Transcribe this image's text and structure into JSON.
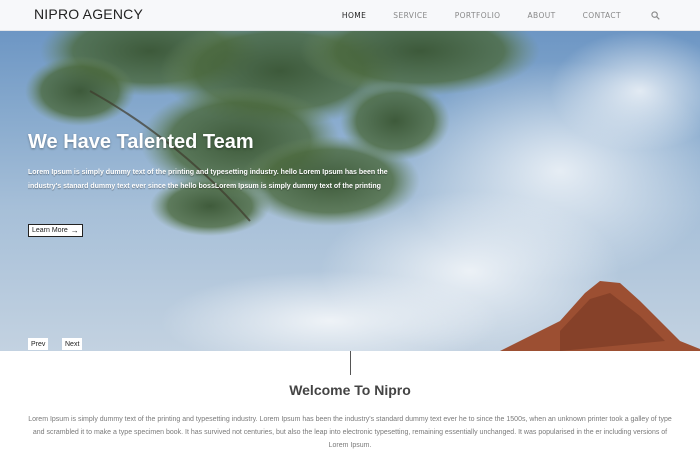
{
  "brand": "NIPRO AGENCY",
  "nav": {
    "items": [
      {
        "label": "HOME",
        "active": true
      },
      {
        "label": "SERVICE",
        "active": false
      },
      {
        "label": "PORTFOLIO",
        "active": false
      },
      {
        "label": "ABOUT",
        "active": false
      },
      {
        "label": "CONTACT",
        "active": false
      }
    ],
    "search_icon": "search-icon"
  },
  "hero": {
    "title": "We Have Talented Team",
    "text": "Lorem Ipsum is simply dummy text of the printing and typesetting industry. hello Lorem Ipsum has been the industry's stanard dummy text ever since the hello bossLorem Ipsum is simply dummy text of the printing",
    "button_label": "Learn More",
    "button_icon": "arrow-right-icon",
    "prev_label": "Prev",
    "next_label": "Next"
  },
  "welcome": {
    "title": "Welcome To Nipro",
    "text": "Lorem Ipsum is simply dummy text of the printing and typesetting industry. Lorem Ipsum has been the industry's standard dummy text ever he to since the 1500s, when an unknown printer took a galley of type and scrambled it to make a type specimen book. It has survived not centuries, but also the leap into electronic typesetting, remaining essentially unchanged. It was popularised in the er including versions of Lorem Ipsum."
  },
  "colors": {
    "nav_bg": "#f7f8fa",
    "sky": "#86a9cd",
    "foliage": "#2f4a2c",
    "rock": "#9c4f32",
    "body_text": "#7a7a7a"
  }
}
